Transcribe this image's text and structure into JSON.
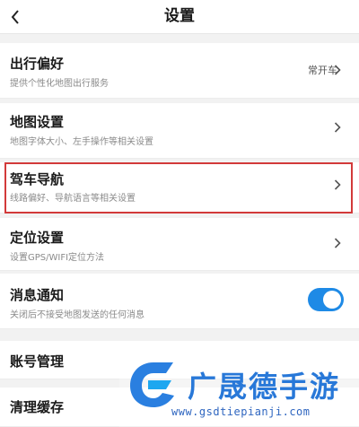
{
  "header": {
    "title": "设置",
    "back_icon": "chevron-left-icon"
  },
  "rows": [
    {
      "title": "出行偏好",
      "subtitle": "提供个性化地图出行服务",
      "value": "常开车"
    },
    {
      "title": "地图设置",
      "subtitle": "地图字体大小、左手操作等相关设置"
    },
    {
      "title": "驾车导航",
      "subtitle": "线路偏好、导航语言等相关设置"
    },
    {
      "title": "定位设置",
      "subtitle": "设置GPS/WIFI定位方法"
    },
    {
      "title": "消息通知",
      "subtitle": "关闭后不接受地图发送的任何消息",
      "toggle_on": true
    },
    {
      "title": "账号管理"
    },
    {
      "title": "清理缓存"
    }
  ],
  "colors": {
    "highlight": "#d23a3a",
    "toggle": "#1e8ae6",
    "watermark": "#2878d8"
  },
  "watermark": {
    "text": "广晟德手游",
    "url": "www.gsdtiepianji.com",
    "logo_icon": "watermark-logo"
  }
}
